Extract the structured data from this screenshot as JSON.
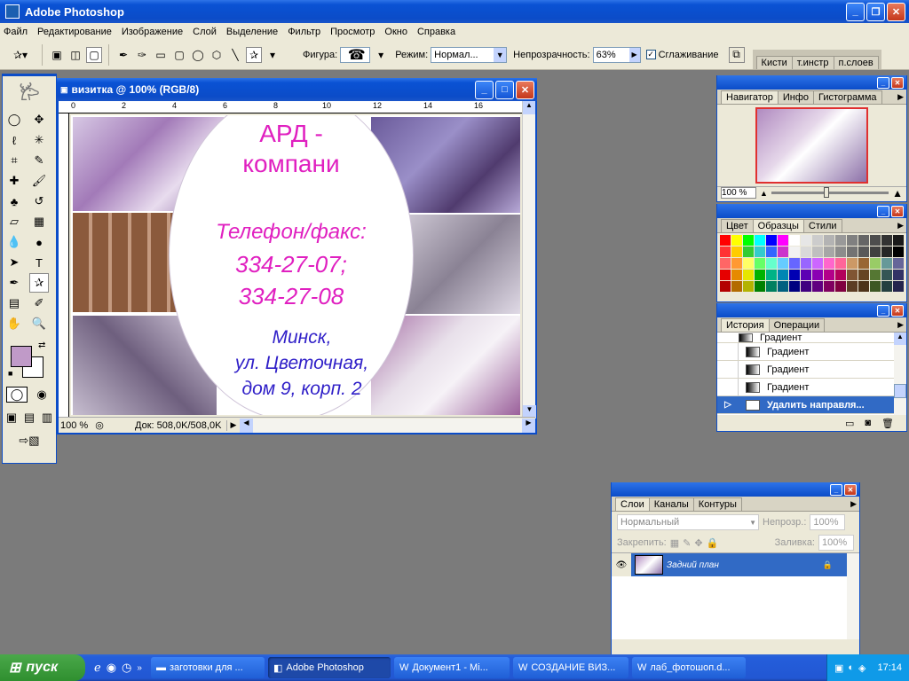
{
  "app": {
    "title": "Adobe Photoshop"
  },
  "menu": [
    "Файл",
    "Редактирование",
    "Изображение",
    "Слой",
    "Выделение",
    "Фильтр",
    "Просмотр",
    "Окно",
    "Справка"
  ],
  "options": {
    "shape_label": "Фигура:",
    "mode_label": "Режим:",
    "mode_value": "Нормал...",
    "opacity_label": "Непрозрачность:",
    "opacity_value": "63%",
    "antialias_label": "Сглаживание",
    "palette_well": [
      "Кисти",
      "т.инстр",
      "п.слоев"
    ]
  },
  "document": {
    "title": "визитка @ 100% (RGB/8)",
    "ruler_ticks": [
      "0",
      "2",
      "4",
      "6",
      "8",
      "10",
      "12",
      "14",
      "16"
    ],
    "status_zoom": "100 %",
    "status_doc": "Док: 508,0K/508,0K",
    "card": {
      "line1": "АРД -",
      "line2": "компани",
      "phone_label": "Телефон/факс:",
      "phone1": "334-27-07;",
      "phone2": "334-27-08",
      "addr1": "Минск,",
      "addr2": "ул. Цветочная,",
      "addr3": "дом 9, корп. 2"
    }
  },
  "navigator": {
    "tabs": [
      "Навигатор",
      "Инфо",
      "Гистограмма"
    ],
    "zoom": "100 %"
  },
  "swatches": {
    "tabs": [
      "Цвет",
      "Образцы",
      "Стили"
    ],
    "colors": [
      "#ff0000",
      "#ffff00",
      "#00ff00",
      "#00ffff",
      "#0000ff",
      "#ff00ff",
      "#ffffff",
      "#e6e6e6",
      "#cccccc",
      "#b3b3b3",
      "#999999",
      "#808080",
      "#666666",
      "#4d4d4d",
      "#333333",
      "#1a1a1a",
      "#ff3333",
      "#ffcc00",
      "#33cc33",
      "#33cccc",
      "#3366ff",
      "#cc33cc",
      "#f2f2f2",
      "#d9d9d9",
      "#bfbfbf",
      "#a6a6a6",
      "#8c8c8c",
      "#737373",
      "#595959",
      "#404040",
      "#262626",
      "#000000",
      "#ff6666",
      "#ff9933",
      "#ffff66",
      "#66ff66",
      "#66ffcc",
      "#66ccff",
      "#6666ff",
      "#9966ff",
      "#cc66ff",
      "#ff66cc",
      "#ff6699",
      "#cc9966",
      "#996633",
      "#99cc66",
      "#669999",
      "#666699",
      "#e60000",
      "#e68a00",
      "#e6e600",
      "#00b300",
      "#00b386",
      "#0086b3",
      "#0000b3",
      "#5c00b3",
      "#8a00b3",
      "#b3008a",
      "#b3005c",
      "#805533",
      "#664422",
      "#557733",
      "#335555",
      "#333366",
      "#b30000",
      "#b36b00",
      "#b3b300",
      "#008000",
      "#008060",
      "#006080",
      "#000080",
      "#400080",
      "#600080",
      "#800060",
      "#800040",
      "#5c3d24",
      "#4d3319",
      "#3d5724",
      "#244040",
      "#24244d"
    ]
  },
  "history": {
    "tabs": [
      "История",
      "Операции"
    ],
    "items": [
      "Градиент",
      "Градиент",
      "Градиент",
      "Градиент",
      "Удалить направля..."
    ]
  },
  "layers": {
    "tabs": [
      "Слои",
      "Каналы",
      "Контуры"
    ],
    "blend": "Нормальный",
    "opacity_label": "Непрозр.:",
    "opacity_value": "100%",
    "lock_label": "Закрепить:",
    "fill_label": "Заливка:",
    "fill_value": "100%",
    "items": [
      {
        "name": "Задний план"
      }
    ]
  },
  "taskbar": {
    "start": "пуск",
    "tasks": [
      "заготовки для ...",
      "Adobe Photoshop",
      "Документ1 - Mi...",
      "СОЗДАНИЕ ВИЗ...",
      "лаб_фотошоп.d..."
    ],
    "clock": "17:14"
  },
  "colors": {
    "foreground": "#c09ac8",
    "background": "#ffffff",
    "card_magenta": "#e020c0",
    "card_blue": "#3020c8"
  }
}
